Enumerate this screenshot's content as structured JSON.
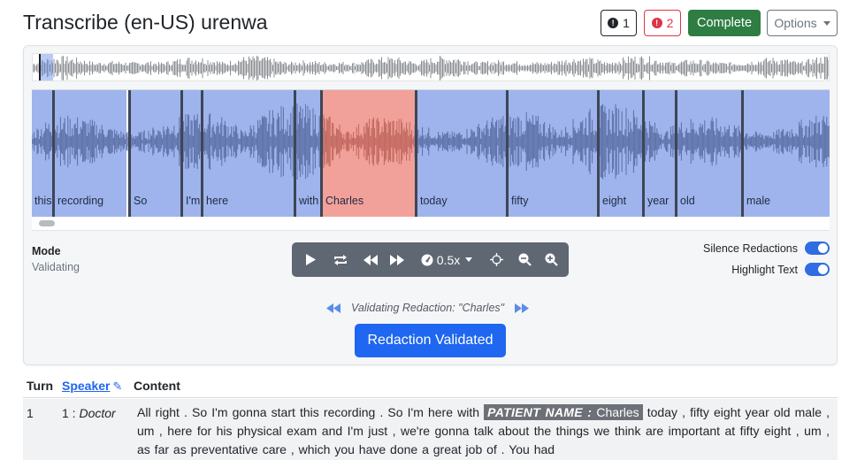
{
  "header": {
    "title": "Transcribe (en-US) urenwa",
    "notes_count": "1",
    "errors_count": "2",
    "complete_label": "Complete",
    "options_label": "Options"
  },
  "waveform": {
    "words": [
      {
        "text": "this",
        "start": 0,
        "end": 23,
        "highlighted": false
      },
      {
        "text": "recording",
        "start": 26,
        "end": 107,
        "highlighted": false
      },
      {
        "text": "So",
        "start": 112,
        "end": 168,
        "highlighted": false
      },
      {
        "text": "I'm",
        "start": 171,
        "end": 191,
        "highlighted": false
      },
      {
        "text": "here",
        "start": 194,
        "end": 296,
        "highlighted": false
      },
      {
        "text": "with",
        "start": 299,
        "end": 326,
        "highlighted": false
      },
      {
        "text": "Charles",
        "start": 329,
        "end": 433,
        "highlighted": true
      },
      {
        "text": "today",
        "start": 436,
        "end": 536,
        "highlighted": false
      },
      {
        "text": "fifty",
        "start": 539,
        "end": 639,
        "highlighted": false
      },
      {
        "text": "eight",
        "start": 642,
        "end": 690,
        "highlighted": false
      },
      {
        "text": "year",
        "start": 693,
        "end": 727,
        "highlighted": false
      },
      {
        "text": "old",
        "start": 730,
        "end": 802,
        "highlighted": false
      },
      {
        "text": "male",
        "start": 805,
        "end": 902,
        "highlighted": false
      }
    ]
  },
  "mode": {
    "label": "Mode",
    "value": "Validating"
  },
  "player": {
    "play_icon": "play-icon",
    "loop_icon": "loop-icon",
    "rewind_icon": "rewind-icon",
    "forward_icon": "fast-forward-icon",
    "rate": "0.5x",
    "rate_icon": "speedometer-icon",
    "center_icon": "crosshair-icon",
    "zoom_out_icon": "zoom-out-icon",
    "zoom_in_icon": "zoom-in-icon"
  },
  "toggles": {
    "silence_label": "Silence Redactions",
    "silence_on": true,
    "highlight_label": "Highlight Text",
    "highlight_on": true
  },
  "validation": {
    "status_text": "Validating Redaction: \"Charles\"",
    "button_label": "Redaction Validated"
  },
  "table": {
    "col_turn": "Turn",
    "col_speaker": "Speaker",
    "col_content": "Content",
    "rows": [
      {
        "turn": "1",
        "speaker_num": "1 :",
        "speaker_role": "Doctor",
        "content_before": "All right . So I'm gonna start this recording . So I'm here with ",
        "redaction_tag": "PATIENT NAME :",
        "redaction_value": " Charles",
        "content_after": " today , fifty eight year old male , um , here for his physical exam and I'm just , we're gonna talk about the things we think are important at fifty eight , um , as far as preventative care , which you have done a great job of . You had"
      }
    ]
  },
  "colors": {
    "primary": "#1f66f0",
    "success": "#2e7d43",
    "danger": "#dc3545",
    "segment": "#9fb4ec",
    "segment_highlight": "#f1a199",
    "toolbar": "#5f6772"
  }
}
